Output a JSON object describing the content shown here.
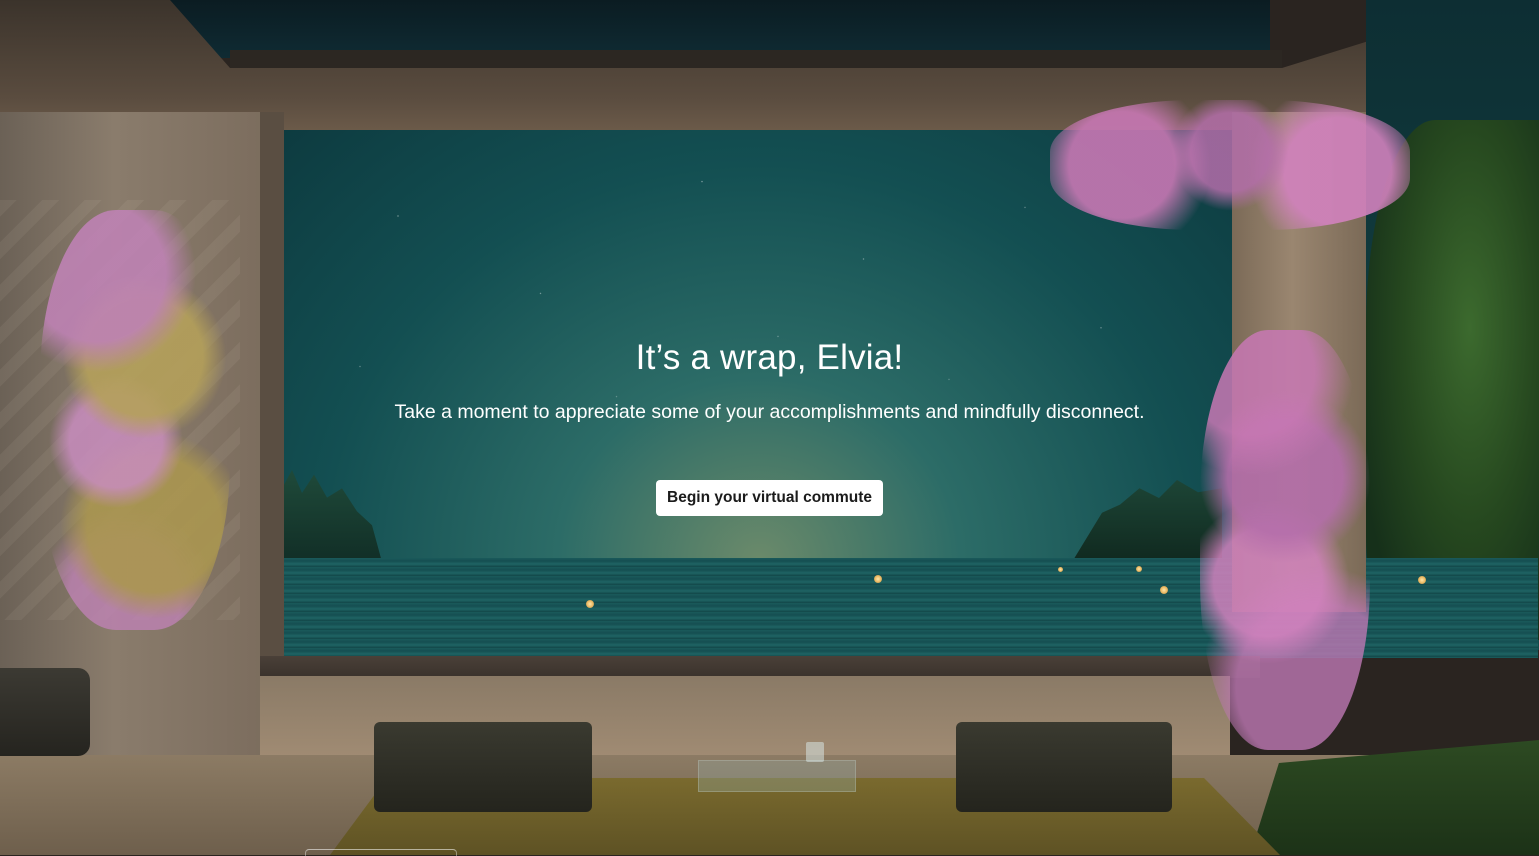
{
  "greeting": {
    "title": "It’s a wrap, Elvia!",
    "subtitle": "Take a moment to appreciate some of your accomplishments and mindfully disconnect."
  },
  "actions": {
    "begin_commute_label": "Begin your virtual commute"
  },
  "colors": {
    "sky_top": "#0d3b40",
    "sky_mid": "#2c6c67",
    "horizon": "#6b8a6a",
    "water": "#1a5a5a",
    "button_bg": "#ffffff",
    "button_text": "#1b1b1b",
    "text": "#ffffff"
  }
}
